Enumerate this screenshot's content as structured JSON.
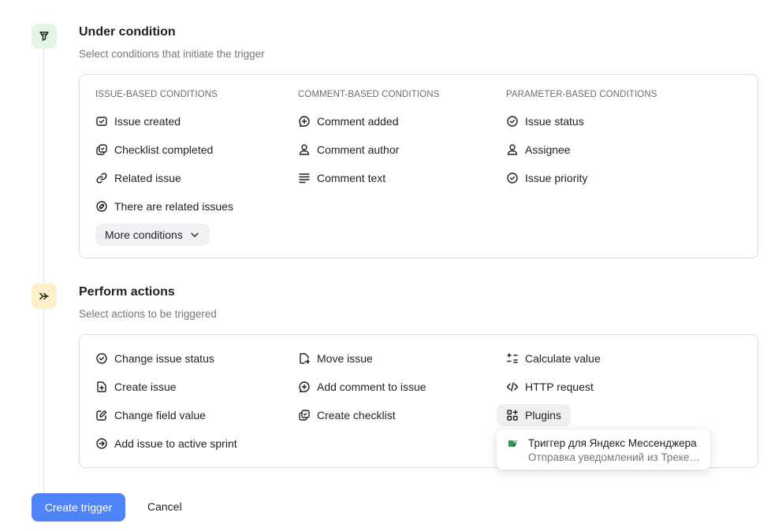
{
  "conditions": {
    "title": "Under condition",
    "subtitle": "Select conditions that initiate the trigger",
    "columns": [
      {
        "header": "ISSUE-BASED CONDITIONS",
        "items": [
          {
            "label": "Issue created",
            "icon": "issue-created-icon"
          },
          {
            "label": "Checklist completed",
            "icon": "checklist-icon"
          },
          {
            "label": "Related issue",
            "icon": "link-icon"
          },
          {
            "label": "There are related issues",
            "icon": "related-issues-icon"
          }
        ]
      },
      {
        "header": "COMMENT-BASED CONDITIONS",
        "items": [
          {
            "label": "Comment added",
            "icon": "comment-plus-icon"
          },
          {
            "label": "Comment author",
            "icon": "person-icon"
          },
          {
            "label": "Comment text",
            "icon": "text-lines-icon"
          }
        ]
      },
      {
        "header": "PARAMETER-BASED CONDITIONS",
        "items": [
          {
            "label": "Issue status",
            "icon": "check-circle-icon"
          },
          {
            "label": "Assignee",
            "icon": "person-icon"
          },
          {
            "label": "Issue priority",
            "icon": "check-circle-icon"
          }
        ]
      }
    ],
    "more_label": "More conditions"
  },
  "actions": {
    "title": "Perform actions",
    "subtitle": "Select actions to be triggered",
    "columns": [
      {
        "items": [
          {
            "label": "Change issue status",
            "icon": "check-circle-icon"
          },
          {
            "label": "Create issue",
            "icon": "file-plus-icon"
          },
          {
            "label": "Change field value",
            "icon": "edit-icon"
          },
          {
            "label": "Add issue to active sprint",
            "icon": "arrow-circle-icon"
          }
        ]
      },
      {
        "items": [
          {
            "label": "Move issue",
            "icon": "move-file-icon"
          },
          {
            "label": "Add comment to issue",
            "icon": "comment-plus-icon"
          },
          {
            "label": "Create checklist",
            "icon": "checklist-icon"
          }
        ]
      },
      {
        "items": [
          {
            "label": "Calculate value",
            "icon": "calculator-icon"
          },
          {
            "label": "HTTP request",
            "icon": "code-icon"
          },
          {
            "label": "Plugins",
            "icon": "plugins-icon"
          }
        ]
      }
    ]
  },
  "plugin_popup": {
    "title": "Триггер для Яндекс Мессенджера",
    "description": "Отправка уведомлений из Трекера в Яндекс Мессенджер",
    "icon": "messenger-logo-icon"
  },
  "footer": {
    "create_label": "Create trigger",
    "cancel_label": "Cancel"
  },
  "colors": {
    "primary": "#4f83f8",
    "condition_step_bg": "#e3f5e3",
    "action_step_bg": "#fdf0c8"
  }
}
